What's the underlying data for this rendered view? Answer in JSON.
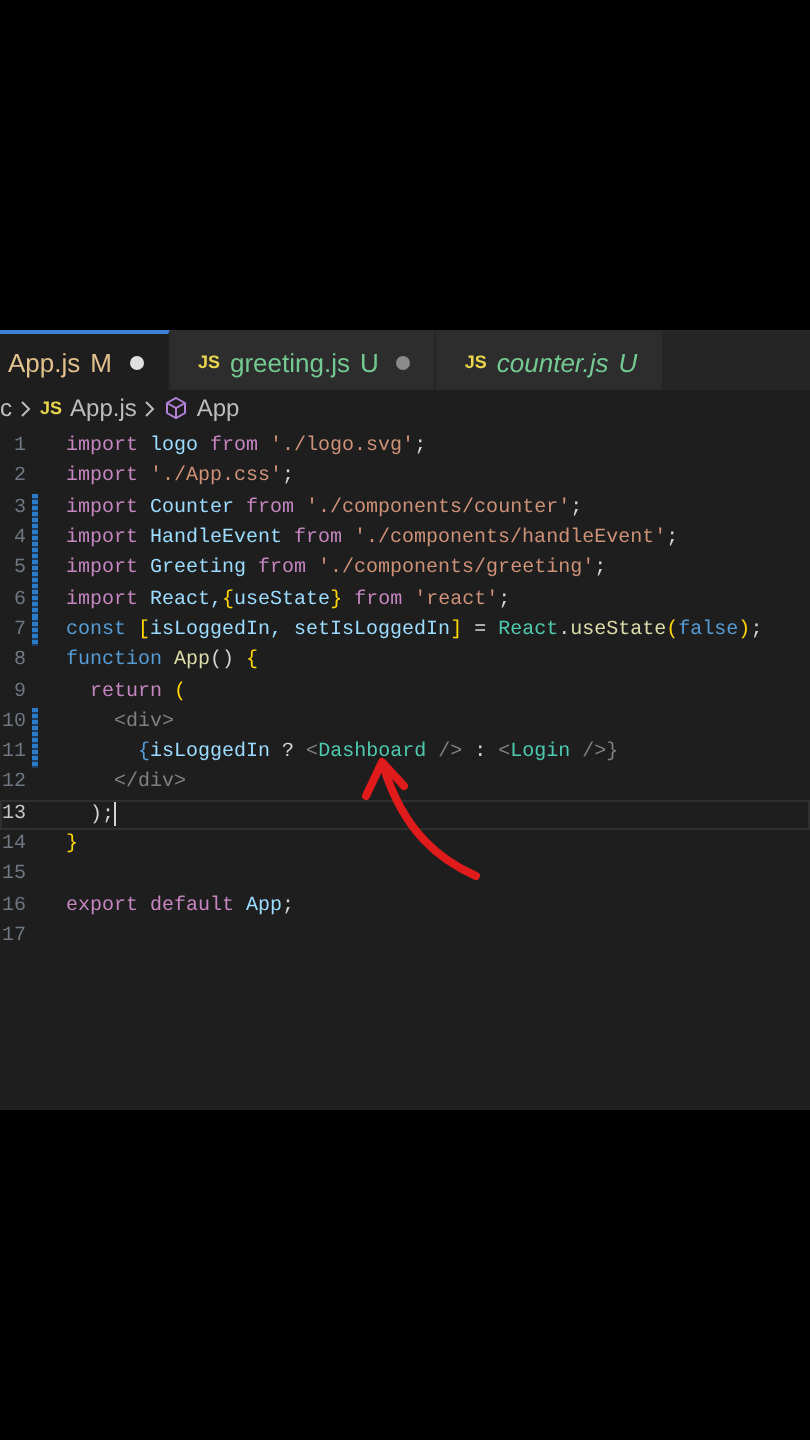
{
  "tabs": [
    {
      "label": "App.js",
      "status": "M",
      "color": "#e2c08d",
      "dirty": true,
      "selected": true,
      "italic": false
    },
    {
      "icon": "JS",
      "label": "greeting.js",
      "status": "U",
      "color": "#73c991",
      "dirty": true,
      "selected": false,
      "italic": false
    },
    {
      "icon": "JS",
      "label": "counter.js",
      "status": "U",
      "color": "#73c991",
      "dirty": false,
      "selected": false,
      "italic": true
    }
  ],
  "breadcrumb": [
    {
      "kind": "folder",
      "text": "c"
    },
    {
      "kind": "file",
      "icon": "JS",
      "text": "App.js"
    },
    {
      "kind": "symbol",
      "text": "App"
    }
  ],
  "lines": [
    {
      "number": "1",
      "modified": false,
      "current": false,
      "tokens": [
        {
          "t": "import ",
          "color": "#c586c0"
        },
        {
          "t": "logo ",
          "color": "#9cdcfe"
        },
        {
          "t": "from ",
          "color": "#c586c0"
        },
        {
          "t": "'./logo.svg'",
          "color": "#ce9178"
        },
        {
          "t": ";",
          "color": "#d4d4d4"
        }
      ]
    },
    {
      "number": "2",
      "modified": false,
      "current": false,
      "tokens": [
        {
          "t": "import ",
          "color": "#c586c0"
        },
        {
          "t": "'./App.css'",
          "color": "#ce9178"
        },
        {
          "t": ";",
          "color": "#d4d4d4"
        }
      ]
    },
    {
      "number": "3",
      "modified": true,
      "current": false,
      "tokens": [
        {
          "t": "import ",
          "color": "#c586c0"
        },
        {
          "t": "Counter ",
          "color": "#9cdcfe"
        },
        {
          "t": "from ",
          "color": "#c586c0"
        },
        {
          "t": "'./components/counter'",
          "color": "#ce9178"
        },
        {
          "t": ";",
          "color": "#d4d4d4"
        }
      ]
    },
    {
      "number": "4",
      "modified": true,
      "current": false,
      "tokens": [
        {
          "t": "import ",
          "color": "#c586c0"
        },
        {
          "t": "HandleEvent ",
          "color": "#9cdcfe"
        },
        {
          "t": "from ",
          "color": "#c586c0"
        },
        {
          "t": "'./components/handleEvent'",
          "color": "#ce9178"
        },
        {
          "t": ";",
          "color": "#d4d4d4"
        }
      ]
    },
    {
      "number": "5",
      "modified": true,
      "current": false,
      "tokens": [
        {
          "t": "import ",
          "color": "#c586c0"
        },
        {
          "t": "Greeting ",
          "color": "#9cdcfe"
        },
        {
          "t": "from ",
          "color": "#c586c0"
        },
        {
          "t": "'./components/greeting'",
          "color": "#ce9178"
        },
        {
          "t": ";",
          "color": "#d4d4d4"
        }
      ]
    },
    {
      "number": "6",
      "modified": true,
      "current": false,
      "tokens": [
        {
          "t": "import ",
          "color": "#c586c0"
        },
        {
          "t": "React,",
          "color": "#9cdcfe"
        },
        {
          "t": "{",
          "color": "#ffd700"
        },
        {
          "t": "useState",
          "color": "#9cdcfe"
        },
        {
          "t": "} ",
          "color": "#ffd700"
        },
        {
          "t": "from ",
          "color": "#c586c0"
        },
        {
          "t": "'react'",
          "color": "#ce9178"
        },
        {
          "t": ";",
          "color": "#d4d4d4"
        }
      ]
    },
    {
      "number": "7",
      "modified": true,
      "current": false,
      "tokens": [
        {
          "t": "const ",
          "color": "#569cd6"
        },
        {
          "t": "[",
          "color": "#ffd700"
        },
        {
          "t": "isLoggedIn, setIsLoggedIn",
          "color": "#9cdcfe"
        },
        {
          "t": "] ",
          "color": "#ffd700"
        },
        {
          "t": "= "
        },
        {
          "t": "React",
          "color": "#4ec9b0"
        },
        {
          "t": ".",
          "color": "#d4d4d4"
        },
        {
          "t": "useState",
          "color": "#dcdcaa"
        },
        {
          "t": "(",
          "color": "#ffd700"
        },
        {
          "t": "false",
          "color": "#569cd6"
        },
        {
          "t": ")",
          "color": "#ffd700"
        },
        {
          "t": ";",
          "color": "#d4d4d4"
        }
      ]
    },
    {
      "number": "8",
      "modified": false,
      "current": false,
      "tokens": [
        {
          "t": "function ",
          "color": "#569cd6"
        },
        {
          "t": "App",
          "color": "#dcdcaa"
        },
        {
          "t": "() ",
          "color": "#d4d4d4"
        },
        {
          "t": "{",
          "color": "#ffd700"
        }
      ]
    },
    {
      "number": "9",
      "modified": false,
      "current": false,
      "tokens": [
        {
          "t": "  return ",
          "color": "#c586c0"
        },
        {
          "t": "(",
          "color": "#ffd700"
        }
      ]
    },
    {
      "number": "10",
      "modified": true,
      "current": false,
      "tokens": [
        {
          "t": "    <div>",
          "color": "#808080"
        }
      ]
    },
    {
      "number": "11",
      "modified": true,
      "current": false,
      "tokens": [
        {
          "t": "      {",
          "color": "#569cd6"
        },
        {
          "t": "isLoggedIn ",
          "color": "#9cdcfe"
        },
        {
          "t": "? ",
          "color": "#d4d4d4"
        },
        {
          "t": "<",
          "color": "#808080"
        },
        {
          "t": "Dashboard ",
          "color": "#4ec9b0"
        },
        {
          "t": "/> ",
          "color": "#808080"
        },
        {
          "t": ": ",
          "color": "#d4d4d4"
        },
        {
          "t": "<",
          "color": "#808080"
        },
        {
          "t": "Login ",
          "color": "#4ec9b0"
        },
        {
          "t": "/>}",
          "color": "#808080"
        }
      ]
    },
    {
      "number": "12",
      "modified": false,
      "current": false,
      "tokens": [
        {
          "t": "    </div>",
          "color": "#808080"
        }
      ]
    },
    {
      "number": "13",
      "modified": false,
      "current": true,
      "tokens": [
        {
          "t": "  );",
          "color": "#d4d4d4"
        }
      ]
    },
    {
      "number": "14",
      "modified": false,
      "current": false,
      "tokens": [
        {
          "t": "}",
          "color": "#ffd700"
        }
      ]
    },
    {
      "number": "15",
      "modified": false,
      "current": false
    },
    {
      "number": "16",
      "modified": false,
      "current": false,
      "tokens": [
        {
          "t": "export ",
          "color": "#c586c0"
        },
        {
          "t": "default ",
          "color": "#c586c0"
        },
        {
          "t": "App",
          "color": "#9cdcfe"
        },
        {
          "t": ";",
          "color": "#d4d4d4"
        }
      ]
    },
    {
      "number": "17",
      "modified": false,
      "current": false
    }
  ]
}
